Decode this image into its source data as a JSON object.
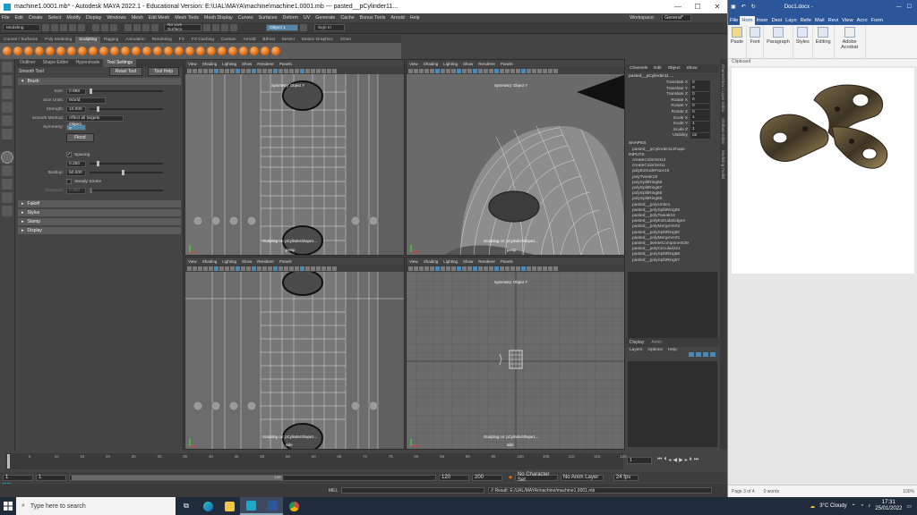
{
  "maya": {
    "title": "machine1.0001.mb* - Autodesk MAYA 2022.1 - Educational Version: E:\\UAL\\MAYA\\machine\\machine1.0001.mb  ---  pasted__pCylinder11...",
    "menus": [
      "File",
      "Edit",
      "Create",
      "Select",
      "Modify",
      "Display",
      "Windows",
      "Mesh",
      "Edit Mesh",
      "Mesh Tools",
      "Mesh Display",
      "Curves",
      "Surfaces",
      "Deform",
      "UV",
      "Generate",
      "Cache",
      "Bonus Tools",
      "Arnold",
      "Help"
    ],
    "workspace_label": "Workspace:",
    "workspace_value": "General*",
    "statusline": {
      "mode": "Modeling",
      "live": "No Live Surface",
      "object": "Object 1",
      "signin": "Sign In"
    },
    "shelf_tabs": [
      "Curves / Surfaces",
      "Poly Modeling",
      "Sculpting",
      "Rigging",
      "Animation",
      "Rendering",
      "FX",
      "FX Caching",
      "Custom",
      "Arnold",
      "Bifrost",
      "MASH",
      "Motion Graphics",
      "XGen"
    ],
    "shelf_active": "Sculpting",
    "toolsettings": {
      "tabs": [
        "Outliner",
        "Shape Editor",
        "Hypershade",
        "Tool Settings"
      ],
      "tool_name": "Smooth Tool",
      "reset": "Reset Tool",
      "help": "Tool Help",
      "brush_frame": "Brush",
      "size_label": "Size:",
      "size_value": "0.988",
      "size_units_label": "Size Units:",
      "size_units_value": "World",
      "strength_label": "Strength:",
      "strength_value": "10.000",
      "smooth_method_label": "Smooth Method:",
      "smooth_method_value": "Affect all targets",
      "symmetry_label": "Symmetry:",
      "symmetry_value": "Object Y",
      "flood": "Flood",
      "spacing_label": "Spacing",
      "spacing_value": "0.250",
      "buildup_label": "Buildup:",
      "buildup_value": "50.000",
      "steady_label": "Steady Stroke",
      "distance_label": "Distance:",
      "distance_value": "0.000",
      "frames": [
        "Falloff",
        "Stylus",
        "Stamp",
        "Display"
      ]
    },
    "viewport_menus": [
      "View",
      "Shading",
      "Lighting",
      "Show",
      "Renderer",
      "Panels"
    ],
    "vp1": {
      "sym": "Symmetry: Object Y",
      "info": "Sculpting on: pCylinderShape1...",
      "cam": "persp"
    },
    "vp2": {
      "sym": "Symmetry: Object Y",
      "info": "Sculpting on: pCylinderShape1...",
      "cam": "persp"
    },
    "vp3": {
      "info": "Sculpting on: pCylinderShape1...",
      "cam": "side"
    },
    "vp4": {
      "sym": "Symmetry: Object Y",
      "info": "Sculpting on: pCylinderShape1...",
      "cam": "side"
    },
    "channelbox": {
      "menus": [
        "Channels",
        "Edit",
        "Object",
        "Show"
      ],
      "object": "pasted__pCylinder11 ...",
      "attrs": [
        {
          "n": "Translate X",
          "v": "0"
        },
        {
          "n": "Translate Y",
          "v": "0"
        },
        {
          "n": "Translate Z",
          "v": "0"
        },
        {
          "n": "Rotate X",
          "v": "0"
        },
        {
          "n": "Rotate Y",
          "v": "0"
        },
        {
          "n": "Rotate Z",
          "v": "0"
        },
        {
          "n": "Scale X",
          "v": "1"
        },
        {
          "n": "Scale Y",
          "v": "1"
        },
        {
          "n": "Scale Z",
          "v": "1"
        },
        {
          "n": "Visibility",
          "v": "on"
        }
      ],
      "shapes_label": "SHAPES",
      "shape": "pasted__pCylinder11Shape",
      "inputs_label": "INPUTS",
      "inputs": [
        "createColorSet13",
        "createColorSet11",
        "polyExtrudeFace19",
        "polyTweak19",
        "polySplitRing68",
        "polySplitRing67",
        "polySplitRing66",
        "polySplitRing65",
        "pasted__polyUnite1",
        "pasted__polySplitRing59",
        "pasted__polyTweak18",
        "pasted__polyExtrudeEdge4",
        "pasted__polyMergeVert3",
        "pasted__polySplitRing60",
        "pasted__polyMergeVert1",
        "pasted__deleteComponent39",
        "pasted__polyCircularize1",
        "pasted__polySplitRing58",
        "pasted__polySplitRing57"
      ]
    },
    "layers": {
      "tabs": [
        "Display",
        "Anim"
      ],
      "menus": [
        "Layers",
        "Options",
        "Help"
      ]
    },
    "side_strip": [
      "Channel Box / Layer Editor",
      "Attribute Editor",
      "Modeling Toolkit"
    ],
    "timeslider": {
      "ticks": [
        "1",
        "5",
        "10",
        "15",
        "20",
        "25",
        "30",
        "35",
        "40",
        "45",
        "50",
        "55",
        "60",
        "65",
        "70",
        "75",
        "80",
        "85",
        "90",
        "95",
        "100",
        "105",
        "110",
        "115",
        "120"
      ],
      "current": "1"
    },
    "range": {
      "start": "1",
      "start2": "1",
      "mid": "120",
      "end": "120",
      "end2": "200",
      "charset": "No Character Set",
      "animlayer": "No Anim Layer",
      "fps": "24 fps"
    },
    "cmd": {
      "lang": "MEL",
      "result": "// Result: E:/UAL/MAYA/machine/machine1.0001.mb"
    }
  },
  "word": {
    "title": "Doc1.docx -",
    "tabs": [
      "File",
      "Hom",
      "Inser",
      "Desi",
      "Layo",
      "Refe",
      "Mail",
      "Revi",
      "View",
      "Acro",
      "Form"
    ],
    "active_tab": "Hom",
    "groups": [
      "Paste",
      "Font",
      "Paragraph",
      "Styles",
      "Editing",
      "Adobe Acrobat"
    ],
    "clipboard": "Clipboard",
    "status_page": "Page 3 of 4",
    "status_words": "0 words",
    "zoom": "100%"
  },
  "taskbar": {
    "search": "Type here to search",
    "weather": "3°C  Cloudy",
    "time": "17:31",
    "date": "25/01/2022"
  }
}
